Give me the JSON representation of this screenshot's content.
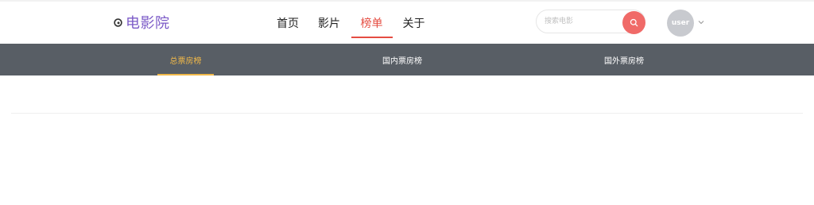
{
  "brand": {
    "name": "电影院",
    "icon": "film-logo-icon"
  },
  "nav": {
    "items": [
      {
        "label": "首页",
        "active": false
      },
      {
        "label": "影片",
        "active": false
      },
      {
        "label": "榜单",
        "active": true
      },
      {
        "label": "关于",
        "active": false
      }
    ]
  },
  "search": {
    "placeholder": "搜索电影",
    "value": "",
    "button_icon": "search-icon"
  },
  "user": {
    "avatar_label": "user",
    "menu_icon": "chevron-down-icon"
  },
  "subnav": {
    "tabs": [
      {
        "label": "总票房榜",
        "active": true
      },
      {
        "label": "国内票房榜",
        "active": false
      },
      {
        "label": "国外票房榜",
        "active": false
      }
    ]
  },
  "colors": {
    "brand": "#7b5ac7",
    "nav_active": "#e54d42",
    "search_button": "#f06a68",
    "subnav_bg": "#585e65",
    "subnav_active": "#f0b849",
    "avatar_bg": "#c8cacf"
  }
}
